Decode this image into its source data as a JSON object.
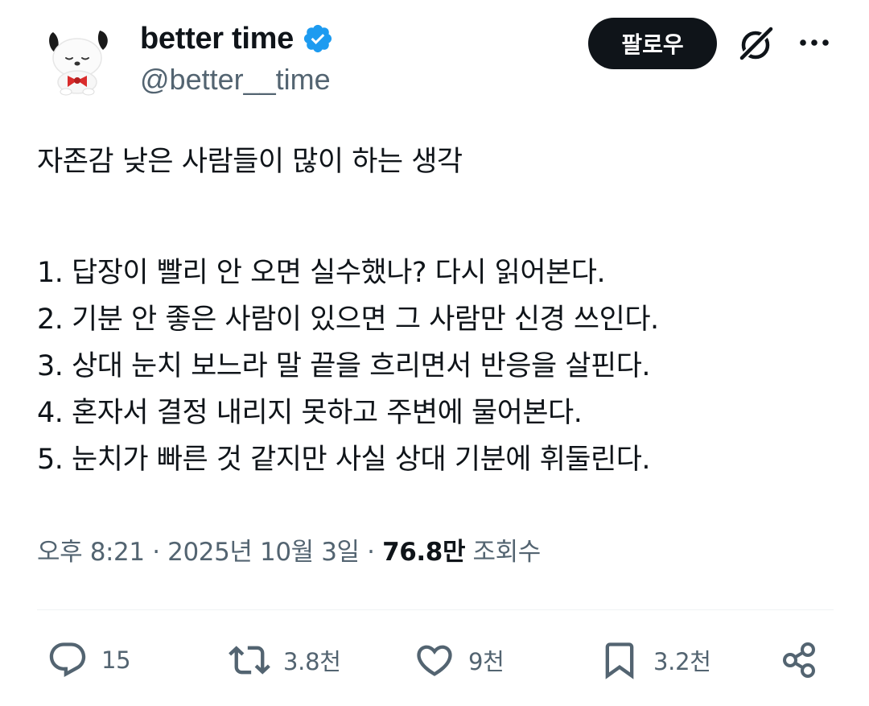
{
  "author": {
    "display_name": "better time",
    "handle": "@better__time",
    "verified": true
  },
  "header": {
    "follow_label": "팔로우",
    "grok_icon": "grok-icon",
    "more_icon": "more-icon"
  },
  "tweet": {
    "title_line": "자존감 낮은 사람들이 많이 하는 생각",
    "lines": [
      "1. 답장이 빨리 안 오면 실수했나? 다시 읽어본다.",
      "2. 기분 안 좋은 사람이 있으면 그 사람만 신경 쓰인다.",
      "3. 상대 눈치 보느라 말 끝을 흐리면서 반응을 살핀다.",
      "4. 혼자서 결정 내리지 못하고 주변에 물어본다.",
      "5. 눈치가 빠른 것 같지만 사실 상대 기분에 휘둘린다."
    ]
  },
  "meta": {
    "time": "오후 8:21",
    "separator": "·",
    "date": "2025년 10월 3일",
    "views_count": "76.8만",
    "views_label": "조회수"
  },
  "actions": {
    "reply_count": "15",
    "retweet_count": "3.8천",
    "like_count": "9천",
    "bookmark_count": "3.2천"
  },
  "colors": {
    "text_primary": "#0f1419",
    "text_secondary": "#536471",
    "verified_blue": "#1d9bf0",
    "follow_bg": "#0f1419",
    "divider": "#eff3f4"
  }
}
